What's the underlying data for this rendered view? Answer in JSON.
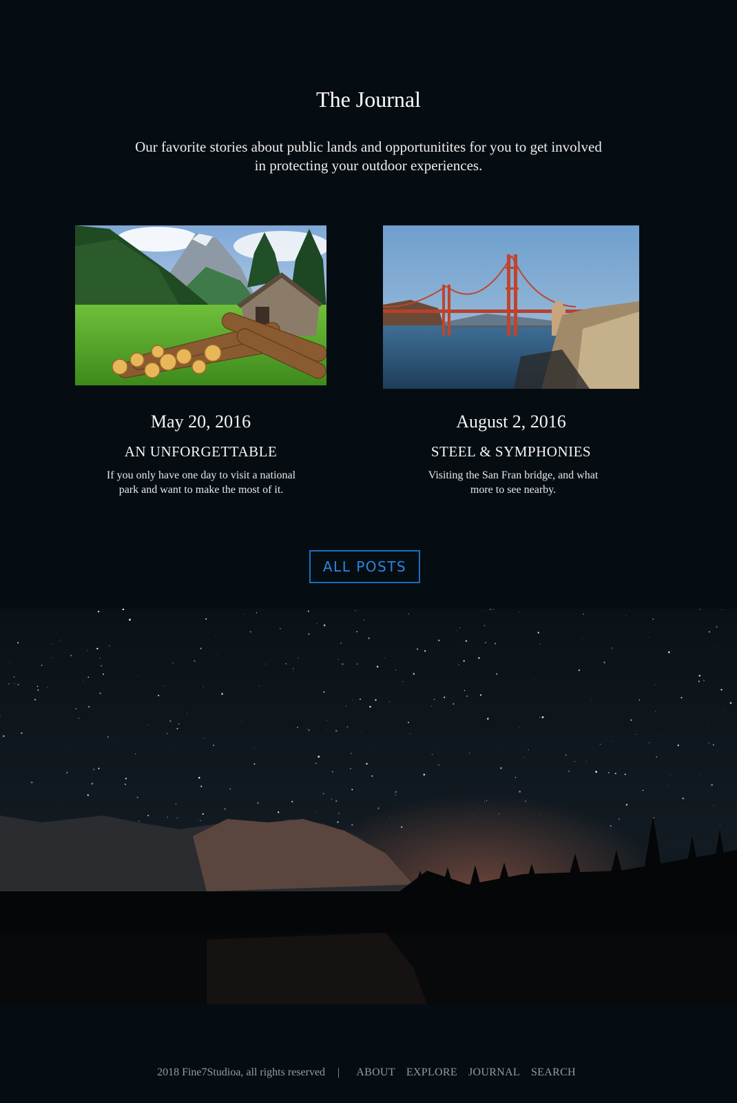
{
  "journal": {
    "title": "The Journal",
    "intro": "Our favorite stories about public lands and opportunitites for you to get involved in protecting your outdoor experiences."
  },
  "posts": [
    {
      "date": "May 20, 2016",
      "title": "AN UNFORGETTABLE",
      "excerpt": "If you only have one day to visit a national park and want to make the most of it."
    },
    {
      "date": "August 2, 2016",
      "title": "STEEL & SYMPHONIES",
      "excerpt": "Visiting the San Fran bridge, and what more to see nearby."
    }
  ],
  "all_posts_label": "ALL POSTS",
  "footer": {
    "copyright": "2018 Fine7Studioa, all rights reserved",
    "separator": "|",
    "links": [
      "ABOUT",
      "EXPLORE",
      "JOURNAL",
      "SEARCH"
    ]
  },
  "colors": {
    "background": "#060d12",
    "accent": "#1e6fbf"
  }
}
